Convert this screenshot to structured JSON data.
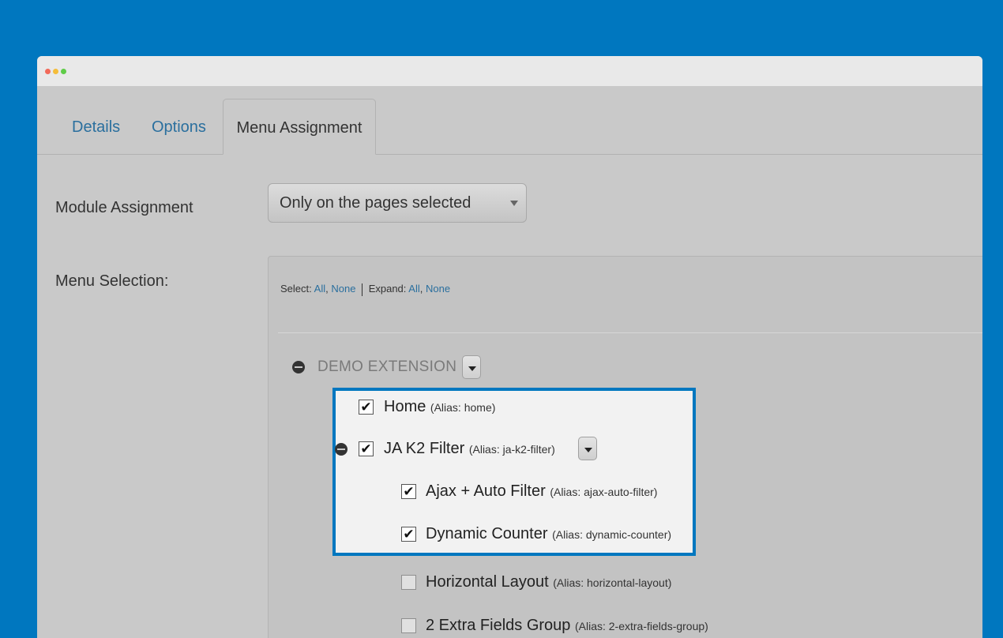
{
  "tabs": [
    {
      "label": "Details"
    },
    {
      "label": "Options"
    },
    {
      "label": "Menu Assignment"
    }
  ],
  "module_assignment": {
    "label": "Module Assignment",
    "selected": "Only on the pages selected"
  },
  "menu_selection": {
    "label": "Menu Selection:",
    "select_prefix": "Select:",
    "select_all": "All",
    "select_none": "None",
    "expand_prefix": "Expand:",
    "expand_all": "All",
    "expand_none": "None",
    "comma": ","
  },
  "tree": {
    "group_title": "DEMO EXTENSION",
    "items": [
      {
        "name": "Home",
        "alias": "(Alias: home)",
        "checked": true
      },
      {
        "name": "JA K2 Filter",
        "alias": "(Alias: ja-k2-filter)",
        "checked": true
      },
      {
        "name": "Ajax + Auto Filter",
        "alias": "(Alias: ajax-auto-filter)",
        "checked": true
      },
      {
        "name": "Dynamic Counter",
        "alias": "(Alias: dynamic-counter)",
        "checked": true
      },
      {
        "name": "Horizontal Layout",
        "alias": "(Alias: horizontal-layout)",
        "checked": false
      },
      {
        "name": "2 Extra Fields Group",
        "alias": "(Alias: 2-extra-fields-group)",
        "checked": false
      }
    ]
  },
  "colors": {
    "background": "#0077bf",
    "link": "#2a6f9e",
    "highlight_border": "#0077bf"
  },
  "check_mark": "✔"
}
